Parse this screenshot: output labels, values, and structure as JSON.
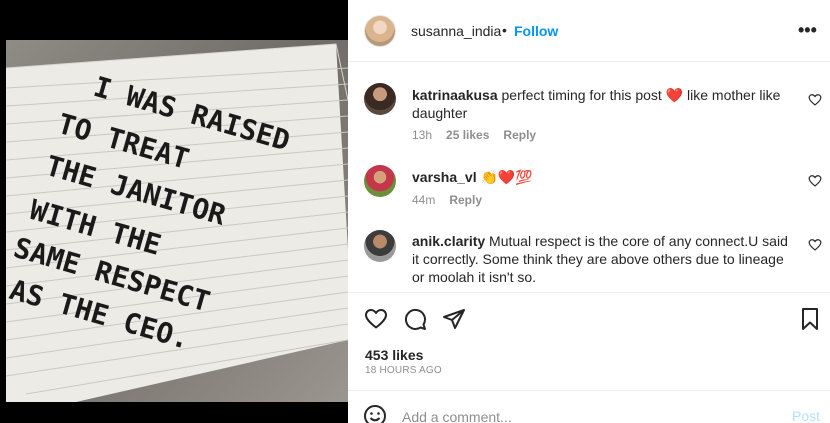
{
  "post": {
    "image_text": [
      "I WAS RAISED",
      "TO TREAT",
      "THE JANITOR",
      "WITH THE",
      "SAME RESPECT",
      "AS THE CEO."
    ]
  },
  "header": {
    "username": "susanna_india",
    "separator": "•",
    "follow_label": "Follow",
    "more_label": "•••"
  },
  "comments": [
    {
      "username": "katrinaakusa",
      "text_before": " perfect timing for this post ",
      "emoji": "❤️",
      "text_after": " like mother like daughter",
      "time": "13h",
      "likes": "25 likes",
      "reply": "Reply"
    },
    {
      "username": "varsha_vl",
      "text_before": " ",
      "emoji": "👏❤️💯",
      "text_after": "",
      "time": "44m",
      "reply": "Reply"
    },
    {
      "username": "anik.clarity",
      "text_before": " Mutual respect is the core of any connect.U said it correctly. Some think they are above others due to lineage or moolah it isn't so.",
      "emoji": "",
      "text_after": ""
    }
  ],
  "likes_count": "453 likes",
  "timestamp": "18 HOURS AGO",
  "add_comment": {
    "placeholder": "Add a comment...",
    "post_label": "Post"
  },
  "colors": {
    "link_blue": "#0095f6",
    "post_disabled": "#b2dffc",
    "muted": "#8e8e8e",
    "heart_red": "#ed4956"
  }
}
